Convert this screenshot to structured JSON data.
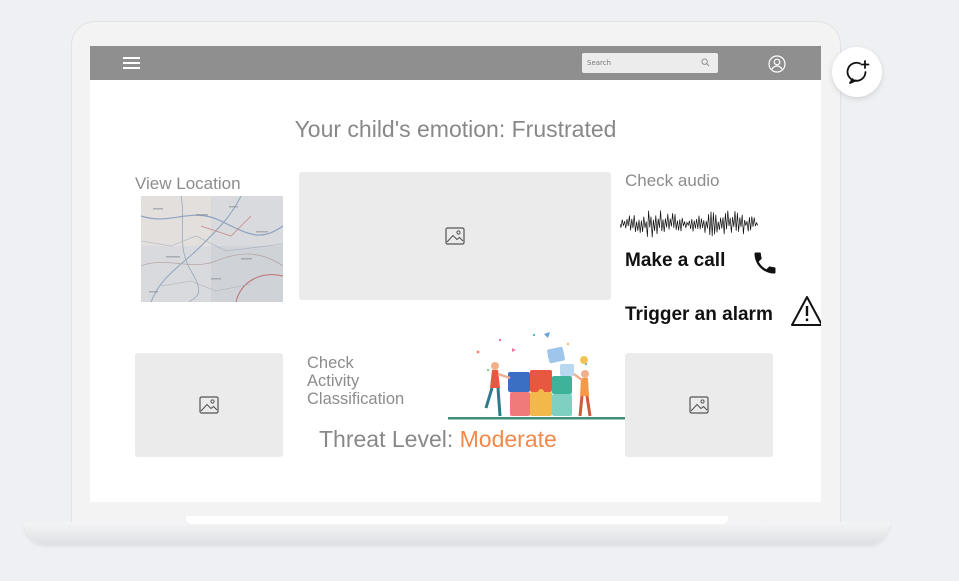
{
  "header": {
    "search": {
      "placeholder": "Search",
      "value": ""
    },
    "icons": {
      "menu": "hamburger-menu-icon",
      "search": "search-icon",
      "profile": "user-icon"
    }
  },
  "main": {
    "emotion_title": "Your child's emotion: Frustrated",
    "view_location_label": "View Location",
    "check_audio_label": "Check audio",
    "make_call_label": "Make a call",
    "trigger_alarm_label": "Trigger an alarm",
    "check_activity_lines": [
      "Check",
      "Activity",
      "Classification"
    ],
    "threat_prefix": "Threat Level:",
    "threat_value": "Moderate"
  },
  "colors": {
    "topbar": "#8f8f8f",
    "threat_accent": "#f2894b",
    "placeholder_bg": "#ebebeb"
  },
  "fab": {
    "icon": "chat-add-icon"
  }
}
